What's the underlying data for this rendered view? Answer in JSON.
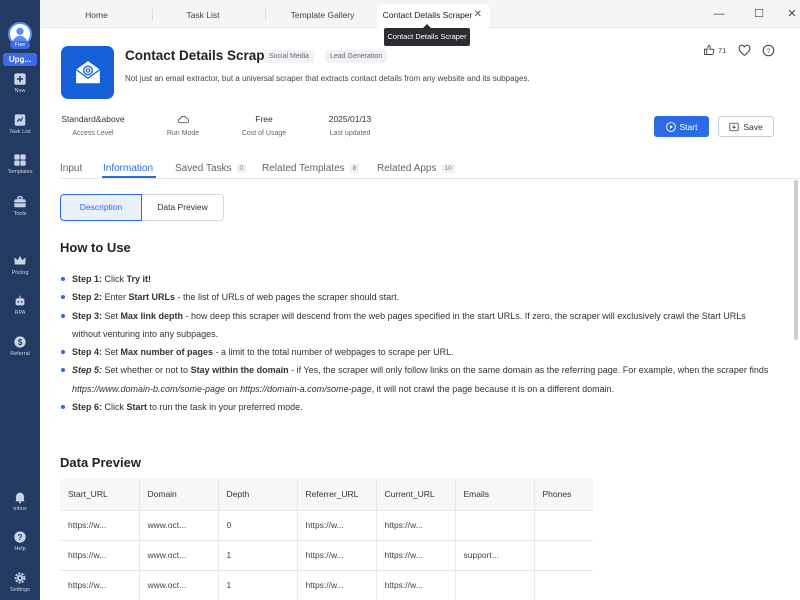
{
  "sidebar": {
    "free_badge": "Free",
    "upgrade_label": "Upg...",
    "items": [
      {
        "label": "New",
        "icon": "plus-square-icon"
      },
      {
        "label": "Task List",
        "icon": "task-list-icon"
      },
      {
        "label": "Templates",
        "icon": "templates-icon"
      },
      {
        "label": "Tools",
        "icon": "toolbox-icon"
      },
      {
        "label": "Pricing",
        "icon": "crown-icon"
      },
      {
        "label": "RPA",
        "icon": "robot-icon"
      },
      {
        "label": "Referral",
        "icon": "dollar-icon"
      },
      {
        "label": "Inbox",
        "icon": "bell-icon"
      },
      {
        "label": "Help",
        "icon": "help-icon"
      },
      {
        "label": "Settings",
        "icon": "gear-icon"
      }
    ]
  },
  "browser_tabs": [
    "Home",
    "Task List",
    "Template Gallery",
    "Contact Details Scraper"
  ],
  "tooltip": "Contact Details Scraper",
  "header": {
    "title": "Contact Details Scraper",
    "tags": [
      "Social Media",
      "Lead Generation"
    ],
    "description": "Not just an email extractor, but a universal scraper that extracts contact details from any website and its subpages.",
    "likes": "71"
  },
  "meta": [
    {
      "value": "Standard&above",
      "label": "Access Level"
    },
    {
      "value": "",
      "label": "Run Mode"
    },
    {
      "value": "Free",
      "label": "Cost of Usage"
    },
    {
      "value": "2025/01/13",
      "label": "Last updated"
    }
  ],
  "actions": {
    "start": "Start",
    "save": "Save"
  },
  "content_tabs": [
    {
      "label": "Input",
      "count": ""
    },
    {
      "label": "Information",
      "count": ""
    },
    {
      "label": "Saved Tasks",
      "count": "0"
    },
    {
      "label": "Related Templates",
      "count": "8"
    },
    {
      "label": "Related Apps",
      "count": "10"
    }
  ],
  "segments": [
    "Description",
    "Data Preview"
  ],
  "how_to_use": {
    "title": "How to Use",
    "steps": [
      [
        {
          "t": "Step 1:",
          "b": true
        },
        {
          "t": " Click "
        },
        {
          "t": "Try it!",
          "b": true
        }
      ],
      [
        {
          "t": "Step 2:",
          "b": true
        },
        {
          "t": " Enter "
        },
        {
          "t": "Start URLs",
          "b": true
        },
        {
          "t": " - the list of URLs of web pages the scraper should start."
        }
      ],
      [
        {
          "t": "Step 3:",
          "b": true
        },
        {
          "t": " Set "
        },
        {
          "t": "Max link depth",
          "b": true
        },
        {
          "t": " - how deep this scraper will descend from the web pages specified in the start URLs. If zero, the scraper will exclusively crawl the Start URLs without venturing into any subpages."
        }
      ],
      [
        {
          "t": "Step 4:",
          "b": true
        },
        {
          "t": " Set "
        },
        {
          "t": "Max number of pages",
          "b": true
        },
        {
          "t": " - a limit to the total number of webpages to scrape per URL."
        }
      ],
      [
        {
          "t": "Step 5:",
          "b": true,
          "i": true
        },
        {
          "t": " Set whether or not to "
        },
        {
          "t": "Stay within the domain",
          "b": true
        },
        {
          "t": " - if Yes, the scraper will only follow links on the same domain as the referring page. For example, when the scraper finds "
        },
        {
          "t": "https://www.domain-b.com/some-page",
          "i": true
        },
        {
          "t": " on "
        },
        {
          "t": "https://domain-a.com/some-page",
          "i": true
        },
        {
          "t": ", it will not crawl the page because it is on a different domain."
        }
      ],
      [
        {
          "t": "Step 6:",
          "b": true
        },
        {
          "t": " Click "
        },
        {
          "t": "Start",
          "b": true
        },
        {
          "t": " to run the task in your preferred mode."
        }
      ]
    ]
  },
  "data_preview": {
    "title": "Data Preview",
    "columns": [
      "Start_URL",
      "Domain",
      "Depth",
      "Referrer_URL",
      "Current_URL",
      "Emails",
      "Phones"
    ],
    "rows": [
      [
        "https://w...",
        "www.oct...",
        "0",
        "https://w...",
        "https://w...",
        "",
        ""
      ],
      [
        "https://w...",
        "www.oct...",
        "1",
        "https://w...",
        "https://w...",
        "support...",
        ""
      ],
      [
        "https://w...",
        "www.oct...",
        "1",
        "https://w...",
        "https://w...",
        "",
        ""
      ]
    ]
  },
  "colors": {
    "sidebar": "#233a63",
    "accent": "#2c6be6",
    "app_icon": "#1560d9"
  }
}
